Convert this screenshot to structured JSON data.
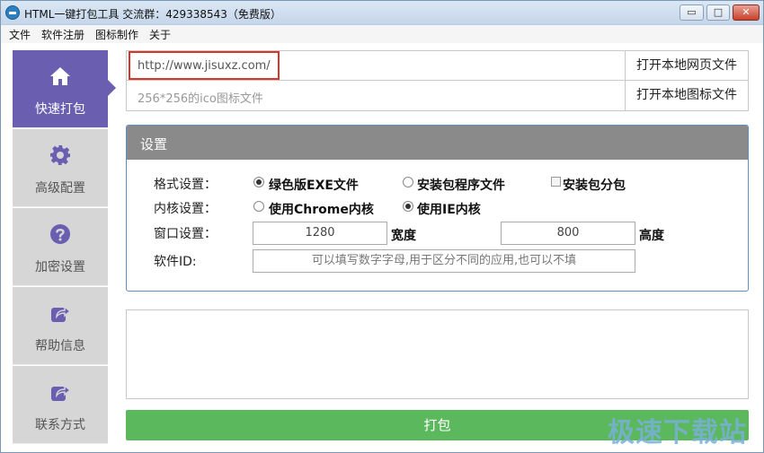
{
  "window": {
    "title": "HTML一键打包工具 交流群：429338543（免费版）",
    "min_label": "▭",
    "max_label": "□",
    "close_label": "✕"
  },
  "menu": [
    "文件",
    "软件注册",
    "图标制作",
    "关于"
  ],
  "sidebar": {
    "items": [
      {
        "label": "快速打包",
        "icon": "home-icon",
        "active": true
      },
      {
        "label": "高级配置",
        "icon": "gear-icon",
        "active": false
      },
      {
        "label": "加密设置",
        "icon": "question-icon",
        "active": false
      },
      {
        "label": "帮助信息",
        "icon": "share-icon",
        "active": false
      },
      {
        "label": "联系方式",
        "icon": "share-icon",
        "active": false
      }
    ]
  },
  "url_input": {
    "value": "http://www.jisuxz.com/"
  },
  "ico_input": {
    "placeholder": "256*256的ico图标文件"
  },
  "buttons": {
    "open_web": "打开本地网页文件",
    "open_ico": "打开本地图标文件",
    "pack": "打包"
  },
  "settings": {
    "title": "设置",
    "format_label": "格式设置：",
    "format_options": [
      "绿色版EXE文件",
      "安装包程序文件",
      "安装包分包"
    ],
    "kernel_label": "内核设置：",
    "kernel_options": [
      "使用Chrome内核",
      "使用IE内核"
    ],
    "window_label": "窗口设置：",
    "width_value": "1280",
    "width_label": "宽度",
    "height_value": "800",
    "height_label": "高度",
    "softid_label": "软件ID:",
    "softid_placeholder": "可以填写数字字母,用于区分不同的应用,也可以不填"
  },
  "watermark": "极速下载站",
  "colors": {
    "sidebar_active": "#6a5eb0",
    "pack_button": "#5cb85c",
    "highlight": "#d9342b"
  }
}
